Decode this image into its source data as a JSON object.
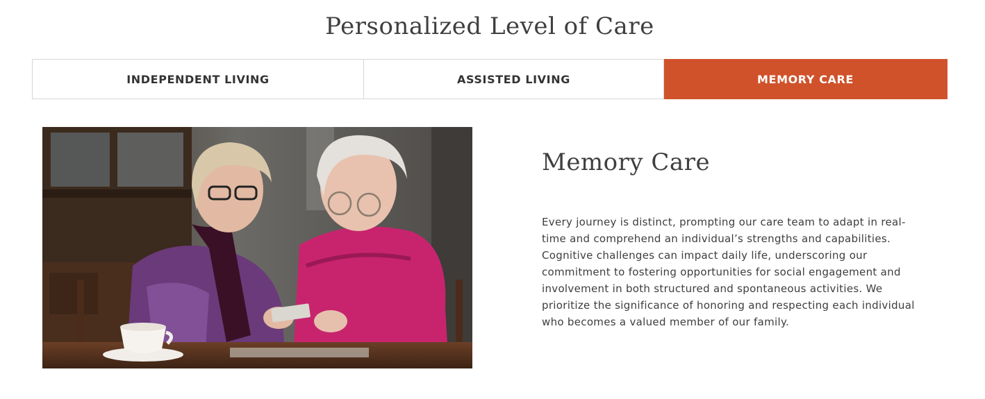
{
  "section": {
    "title": "Personalized Level of Care"
  },
  "tabs": [
    {
      "label": "INDEPENDENT LIVING",
      "active": false
    },
    {
      "label": "ASSISTED LIVING",
      "active": false
    },
    {
      "label": "MEMORY CARE",
      "active": true
    }
  ],
  "panel": {
    "title": "Memory Care",
    "body": "Every journey is distinct, prompting our care team to adapt in real-time and comprehend an individual’s strengths and capabilities. Cognitive challenges can impact daily life, underscoring our commitment to fostering opportunities for social engagement and involvement in both structured and spontaneous activities. We prioritize the significance of honoring and respecting each individual who becomes a valued member of our family.",
    "image_alt": "Two women looking at photographs together at a table"
  },
  "colors": {
    "accent": "#d0522a",
    "text": "#3d3d3d",
    "tab_border": "#d6d6d6"
  }
}
